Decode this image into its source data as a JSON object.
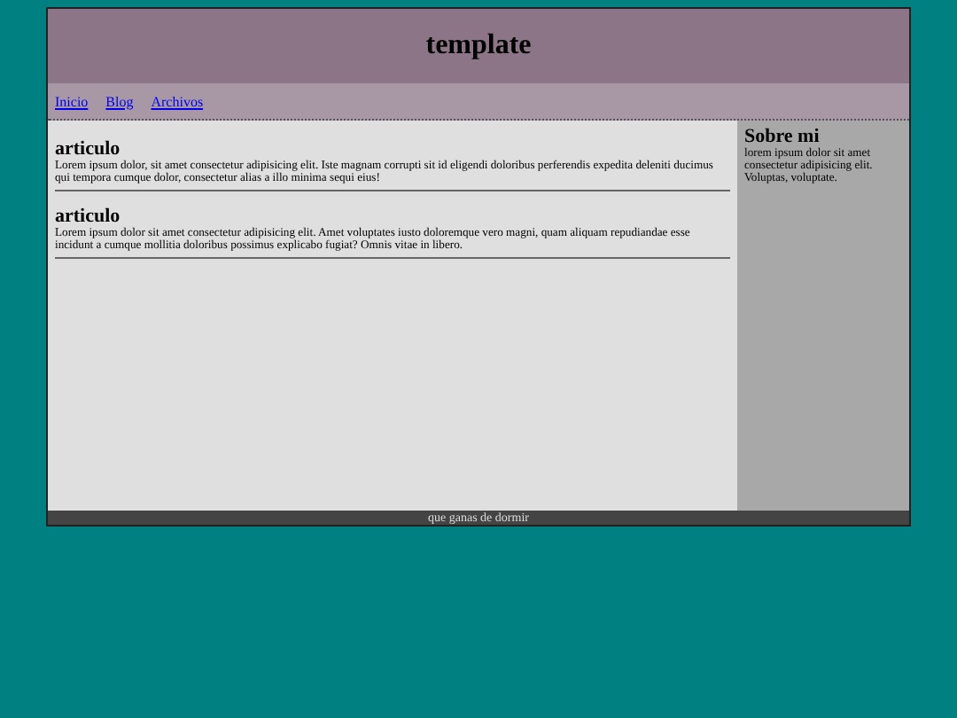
{
  "header": {
    "title": "template"
  },
  "nav": {
    "links": [
      "Inicio",
      "Blog",
      "Archivos"
    ]
  },
  "articles": [
    {
      "title": "articulo",
      "body": "Lorem ipsum dolor, sit amet consectetur adipisicing elit. Iste magnam corrupti sit id eligendi doloribus perferendis expedita deleniti ducimus qui tempora cumque dolor, consectetur alias a illo minima sequi eius!"
    },
    {
      "title": "articulo",
      "body": "Lorem ipsum dolor sit amet consectetur adipisicing elit. Amet voluptates iusto doloremque vero magni, quam aliquam repudiandae esse incidunt a cumque mollitia doloribus possimus explicabo fugiat? Omnis vitae in libero."
    }
  ],
  "sidebar": {
    "title": "Sobre mi",
    "text": "lorem ipsum dolor sit amet consectetur adipisicing elit. Voluptas, voluptate."
  },
  "footer": {
    "text": "que ganas de dormir"
  }
}
